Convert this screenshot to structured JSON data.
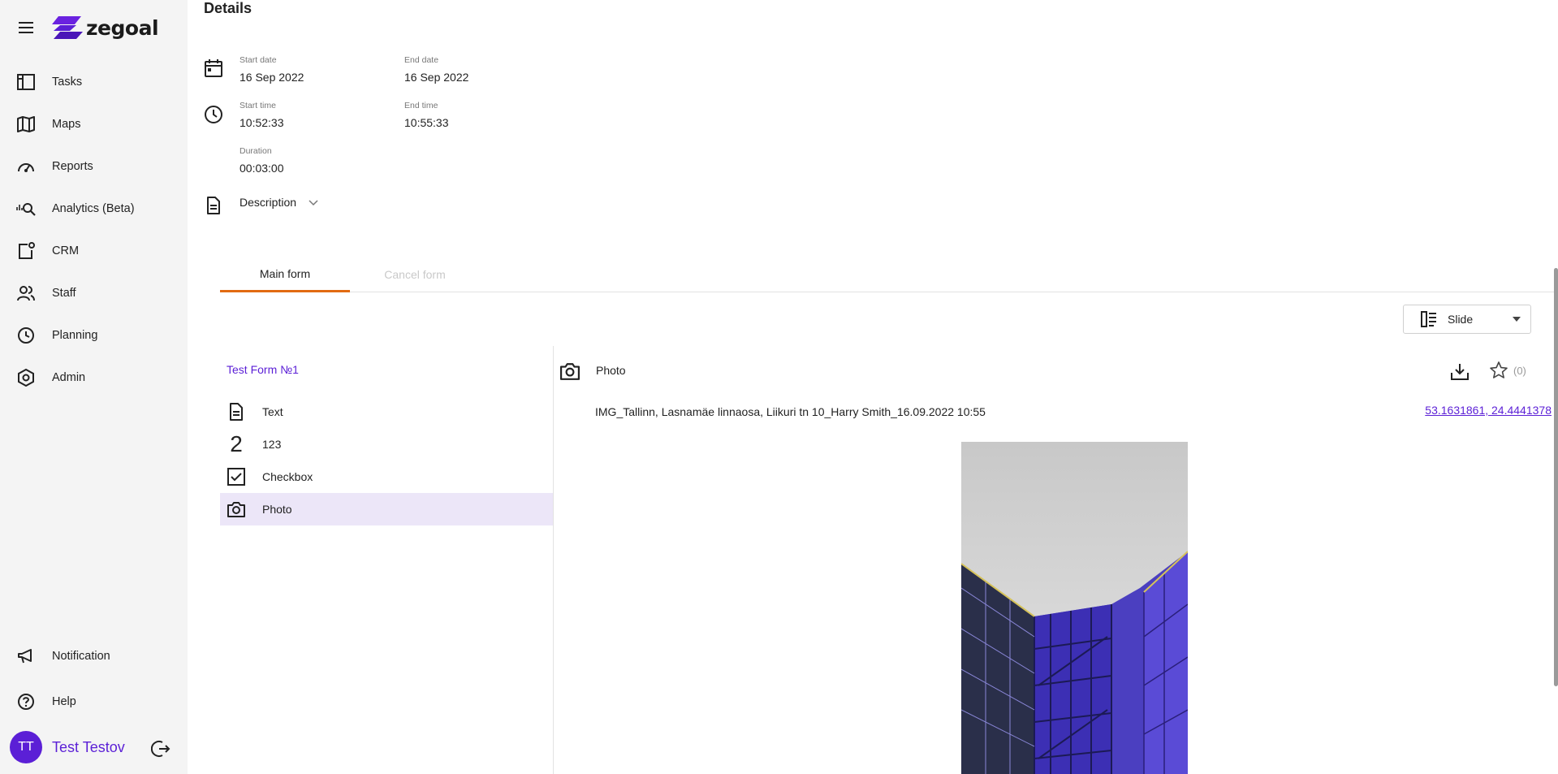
{
  "app": {
    "logo_text": "zegoal",
    "brand_color": "#5b1fd6",
    "accent_color": "#e26b12"
  },
  "sidebar": {
    "items": [
      {
        "label": "Tasks",
        "icon": "tasks-icon"
      },
      {
        "label": "Maps",
        "icon": "map-icon"
      },
      {
        "label": "Reports",
        "icon": "speedometer-icon"
      },
      {
        "label": "Analytics (Beta)",
        "icon": "analytics-search-icon"
      },
      {
        "label": "CRM",
        "icon": "crm-icon"
      },
      {
        "label": "Staff",
        "icon": "staff-icon"
      },
      {
        "label": "Planning",
        "icon": "clock-icon"
      },
      {
        "label": "Admin",
        "icon": "admin-icon"
      }
    ],
    "bottom_items": [
      {
        "label": "Notification",
        "icon": "megaphone-icon"
      },
      {
        "label": "Help",
        "icon": "help-icon"
      }
    ],
    "user": {
      "initials": "TT",
      "name": "Test Testov"
    }
  },
  "details": {
    "title": "Details",
    "start_date_label": "Start date",
    "start_date": "16 Sep 2022",
    "end_date_label": "End date",
    "end_date": "16 Sep 2022",
    "start_time_label": "Start time",
    "start_time": "10:52:33",
    "end_time_label": "End time",
    "end_time": "10:55:33",
    "duration_label": "Duration",
    "duration": "00:03:00",
    "description_label": "Description"
  },
  "tabs": [
    {
      "label": "Main form",
      "active": true
    },
    {
      "label": "Cancel form",
      "active": false
    }
  ],
  "view_select": {
    "value": "Slide"
  },
  "form": {
    "title": "Test Form №1",
    "items": [
      {
        "label": "Text",
        "icon": "document-icon"
      },
      {
        "label": "123",
        "icon": "number-icon",
        "glyph": "2"
      },
      {
        "label": "Checkbox",
        "icon": "checkbox-icon"
      },
      {
        "label": "Photo",
        "icon": "camera-icon",
        "active": true
      }
    ]
  },
  "photo": {
    "title": "Photo",
    "caption": "IMG_Tallinn, Lasnamäe linnaosa, Liikuri tn 10_Harry Smith_16.09.2022 10:55",
    "coordinates": "53.1631861, 24.4441378",
    "rating_count": "(0)"
  }
}
